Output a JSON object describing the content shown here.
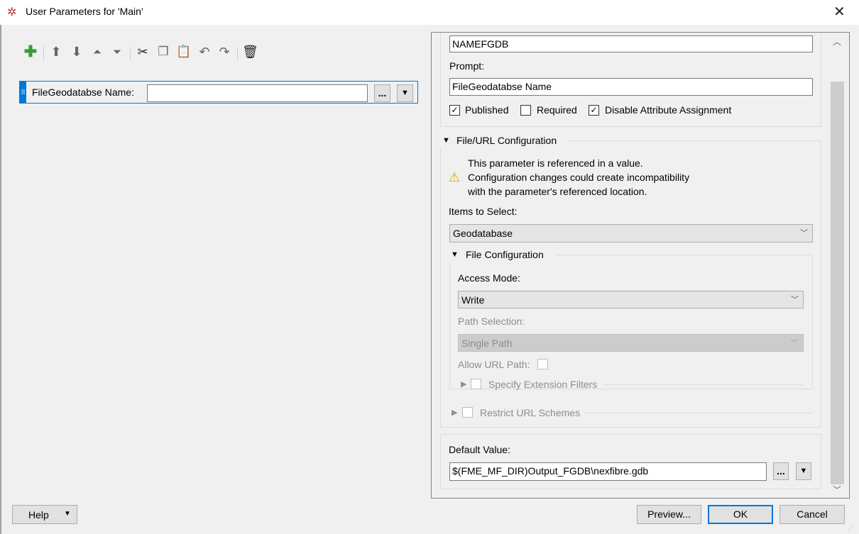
{
  "window": {
    "title": "User Parameters for 'Main'",
    "close_icon": "close-icon"
  },
  "toolbar": {
    "icons": [
      "add-parameter-icon",
      "move-up-icon",
      "move-down-icon",
      "move-top-icon",
      "move-bottom-icon",
      "cut-icon",
      "copy-icon",
      "paste-icon",
      "undo-icon",
      "redo-icon",
      "delete-icon"
    ]
  },
  "parameter_list": [
    {
      "label": "FileGeodatabse Name:",
      "value": "",
      "browse": "...",
      "menu": "▼"
    }
  ],
  "editor": {
    "name_value": "NAMEFGDB",
    "prompt_label": "Prompt:",
    "prompt_value": "FileGeodatabse Name",
    "checkboxes": [
      {
        "label": "Published",
        "checked": true
      },
      {
        "label": "Required",
        "checked": false
      },
      {
        "label": "Disable Attribute Assignment",
        "checked": true
      }
    ],
    "file_url_config": {
      "title": "File/URL Configuration",
      "warning": [
        "This parameter is referenced in a value.",
        "Configuration changes could create incompatibility",
        "with the parameter's referenced location."
      ],
      "items_label": "Items to Select:",
      "items_value": "Geodatabase",
      "file_config": {
        "title": "File Configuration",
        "access_label": "Access Mode:",
        "access_value": "Write",
        "path_label": "Path Selection:",
        "path_value": "Single Path",
        "allow_url_label": "Allow URL Path:",
        "ext_filters_label": "Specify Extension Filters"
      },
      "restrict_label": "Restrict URL Schemes"
    },
    "default_label": "Default Value:",
    "default_value": "$(FME_MF_DIR)Output_FGDB\\nexfibre.gdb",
    "browse": "...",
    "menu": "▼"
  },
  "buttons": {
    "help": "Help",
    "help_menu": "▼",
    "preview": "Preview...",
    "ok": "OK",
    "cancel": "Cancel"
  },
  "check_mark": "✓"
}
